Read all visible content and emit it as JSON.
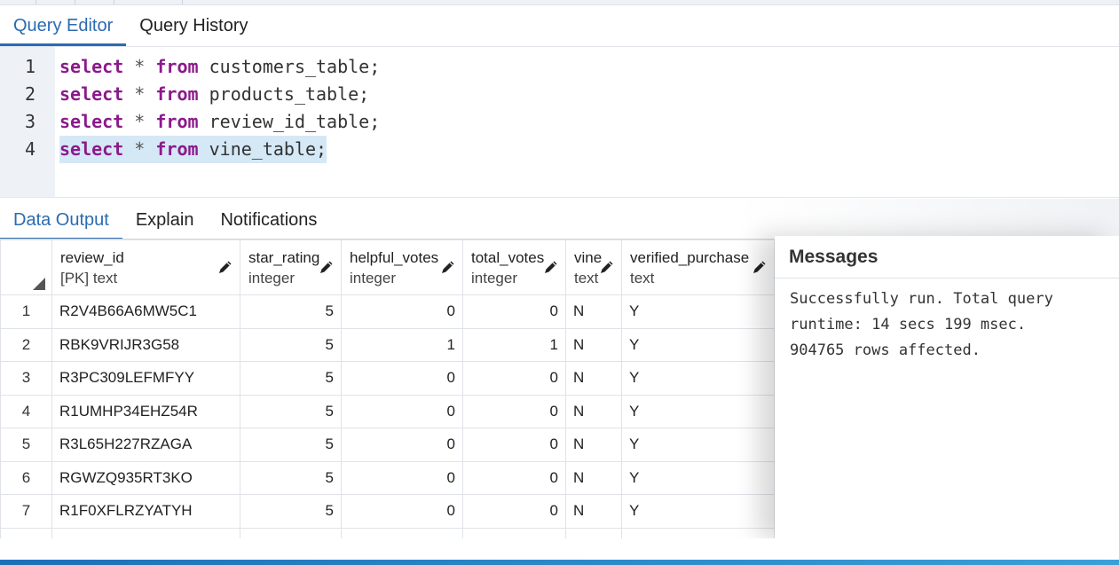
{
  "editor_tabs": [
    {
      "label": "Query Editor",
      "active": true
    },
    {
      "label": "Query History",
      "active": false
    }
  ],
  "editor": {
    "lines": [
      {
        "number": "1",
        "keyword1": "select",
        "star": "*",
        "keyword2": "from",
        "rest": "customers_table;"
      },
      {
        "number": "2",
        "keyword1": "select",
        "star": "*",
        "keyword2": "from",
        "rest": "products_table;"
      },
      {
        "number": "3",
        "keyword1": "select",
        "star": "*",
        "keyword2": "from",
        "rest": "review_id_table;"
      },
      {
        "number": "4",
        "keyword1": "select",
        "star": "*",
        "keyword2": "from",
        "rest": "vine_table;"
      }
    ],
    "highlighted_line": 4
  },
  "output_tabs": [
    {
      "label": "Data Output",
      "active": true
    },
    {
      "label": "Explain",
      "active": false
    },
    {
      "label": "Notifications",
      "active": false
    }
  ],
  "grid": {
    "columns": [
      {
        "name": "review_id",
        "type": "[PK] text",
        "align": "left"
      },
      {
        "name": "star_rating",
        "type": "integer",
        "align": "right"
      },
      {
        "name": "helpful_votes",
        "type": "integer",
        "align": "right"
      },
      {
        "name": "total_votes",
        "type": "integer",
        "align": "right"
      },
      {
        "name": "vine",
        "type": "text",
        "align": "left"
      },
      {
        "name": "verified_purchase",
        "type": "text",
        "align": "left"
      }
    ],
    "rows": [
      {
        "n": "1",
        "cells": [
          "R2V4B66A6MW5C1",
          "5",
          "0",
          "0",
          "N",
          "Y"
        ]
      },
      {
        "n": "2",
        "cells": [
          "RBK9VRIJR3G58",
          "5",
          "1",
          "1",
          "N",
          "Y"
        ]
      },
      {
        "n": "3",
        "cells": [
          "R3PC309LEFMFYY",
          "5",
          "0",
          "0",
          "N",
          "Y"
        ]
      },
      {
        "n": "4",
        "cells": [
          "R1UMHP34EHZ54R",
          "5",
          "0",
          "0",
          "N",
          "Y"
        ]
      },
      {
        "n": "5",
        "cells": [
          "R3L65H227RZAGA",
          "5",
          "0",
          "0",
          "N",
          "Y"
        ]
      },
      {
        "n": "6",
        "cells": [
          "RGWZQ935RT3KO",
          "5",
          "0",
          "0",
          "N",
          "Y"
        ]
      },
      {
        "n": "7",
        "cells": [
          "R1F0XFLRZYATYH",
          "5",
          "0",
          "0",
          "N",
          "Y"
        ]
      }
    ]
  },
  "messages": {
    "title": "Messages",
    "lines": [
      "Successfully run. Total query",
      "runtime: 14 secs 199 msec.",
      "904765 rows affected."
    ]
  },
  "colors": {
    "accent": "#2a6bb0",
    "keyword": "#8b1a8b",
    "line_highlight": "#d5e8f6",
    "gutter": "#eef2f6"
  },
  "icons": {
    "column_edit": "pencil-icon",
    "select_all": "corner-triangle-icon"
  }
}
